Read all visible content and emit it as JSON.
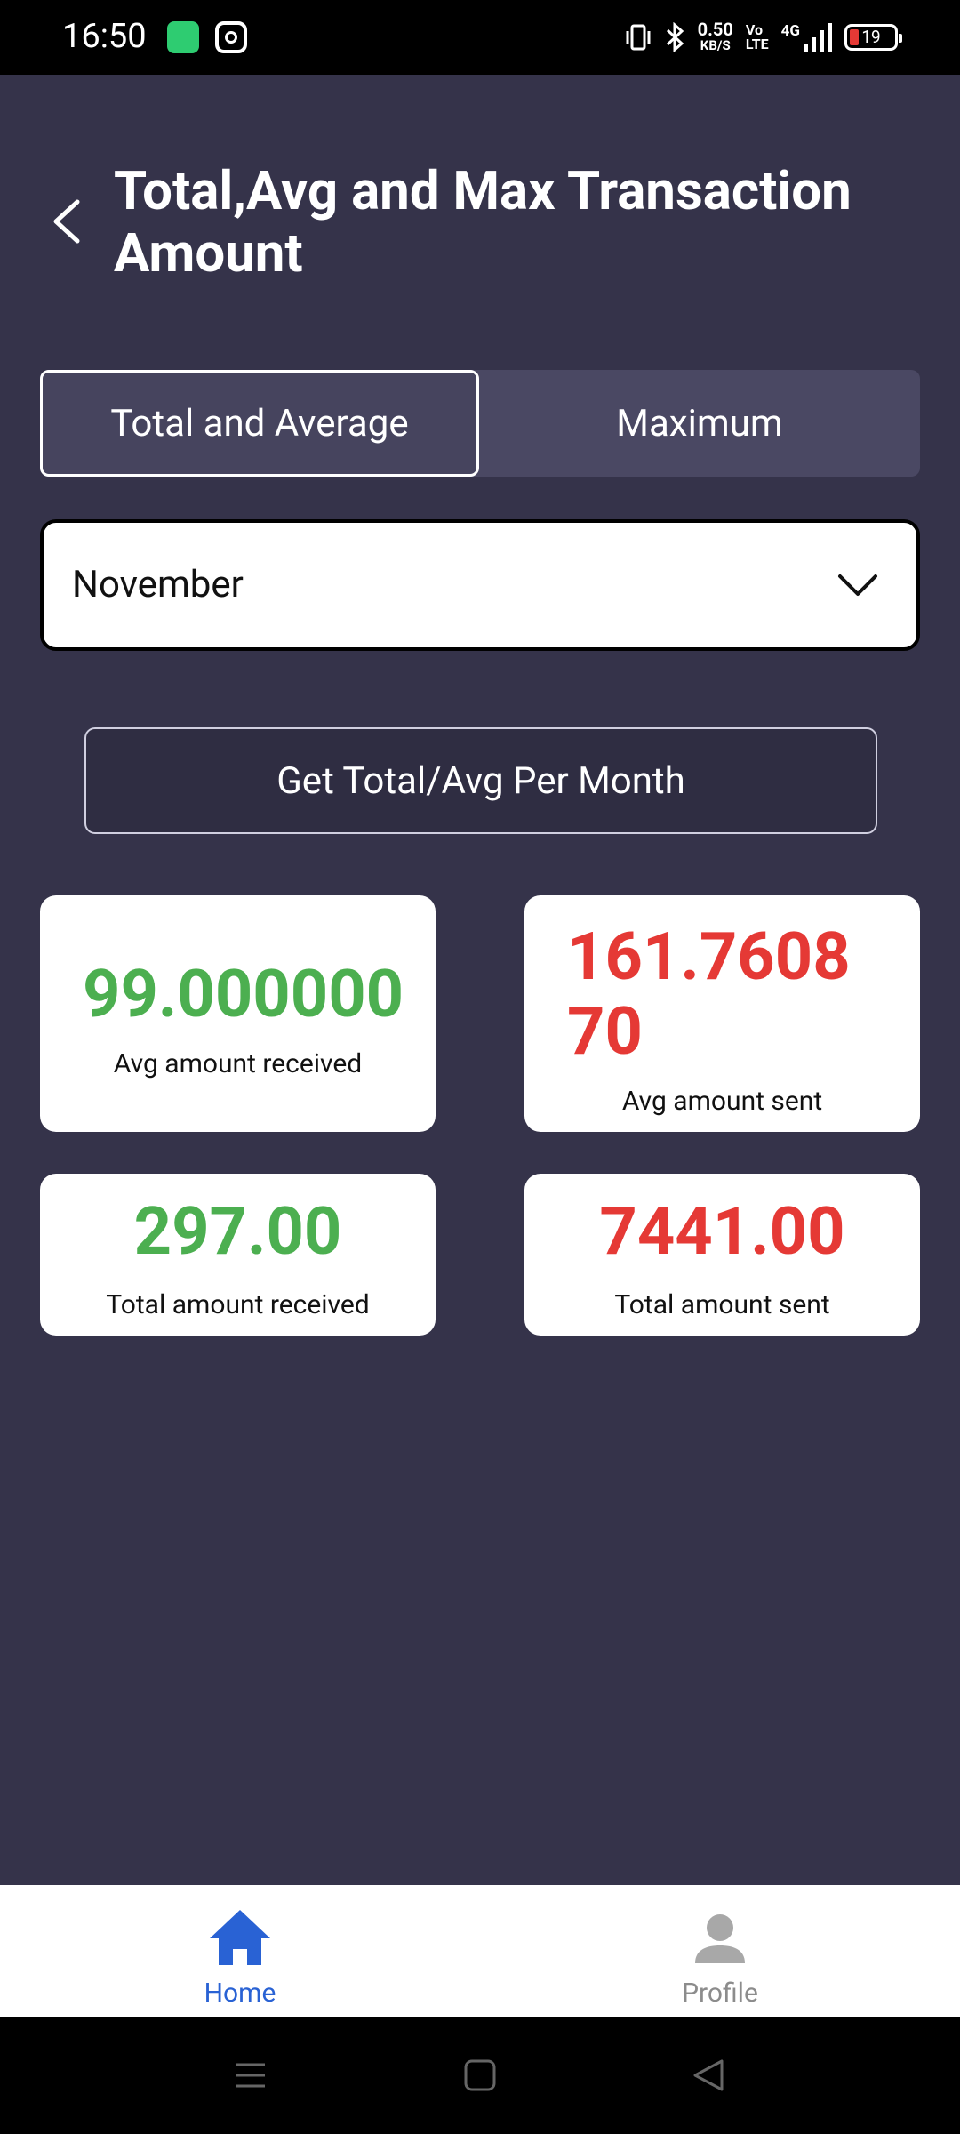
{
  "status_bar": {
    "time": "16:50",
    "network_speed_value": "0.50",
    "network_speed_unit": "KB/S",
    "volte_top": "Vo",
    "volte_bottom": "LTE",
    "network_type": "4G",
    "battery_level": "19"
  },
  "header": {
    "title": "Total,Avg and Max Transaction Amount"
  },
  "tabs": [
    {
      "label": "Total and Average",
      "active": true
    },
    {
      "label": "Maximum",
      "active": false
    }
  ],
  "month_select": {
    "selected": "November"
  },
  "action_button": {
    "label": "Get Total/Avg Per Month"
  },
  "stats": {
    "avg_received": {
      "value": "99.000000",
      "label": "Avg amount received"
    },
    "avg_sent": {
      "value": "161.760870",
      "label": "Avg amount sent"
    },
    "total_received": {
      "value": "297.00",
      "label": "Total amount received"
    },
    "total_sent": {
      "value": "7441.00",
      "label": "Total amount sent"
    }
  },
  "bottom_nav": {
    "items": [
      {
        "label": "Home",
        "icon": "home-icon",
        "active": true
      },
      {
        "label": "Profile",
        "icon": "person-icon",
        "active": false
      }
    ]
  },
  "colors": {
    "background": "#35334a",
    "received": "#4caf50",
    "sent": "#e53935",
    "nav_active": "#2962d4",
    "nav_inactive": "#8c8c8c"
  }
}
